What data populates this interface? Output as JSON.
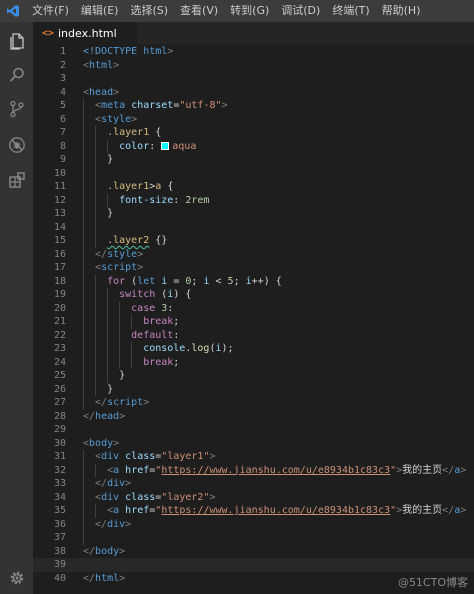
{
  "menubar": {
    "items": [
      "文件(F)",
      "编辑(E)",
      "选择(S)",
      "查看(V)",
      "转到(G)",
      "调试(D)",
      "终端(T)",
      "帮助(H)"
    ]
  },
  "activity_bar": {
    "icons": [
      "explorer-icon",
      "search-icon",
      "source-control-icon",
      "debug-icon",
      "extensions-icon",
      "settings-gear-icon"
    ]
  },
  "tab": {
    "icon": "<>",
    "filename": "index.html"
  },
  "editor": {
    "current_line": 39,
    "lines": [
      {
        "n": "1",
        "depth": 0,
        "tokens": [
          {
            "t": "<!DOCTYPE ",
            "c": "t-storage"
          },
          {
            "t": "html",
            "c": "t-tag"
          },
          {
            "t": ">",
            "c": "t-punc"
          }
        ]
      },
      {
        "n": "2",
        "depth": 0,
        "tokens": [
          {
            "t": "<",
            "c": "t-punc"
          },
          {
            "t": "html",
            "c": "t-tag"
          },
          {
            "t": ">",
            "c": "t-punc"
          }
        ]
      },
      {
        "n": "3",
        "depth": 0,
        "tokens": []
      },
      {
        "n": "4",
        "depth": 0,
        "tokens": [
          {
            "t": "<",
            "c": "t-punc"
          },
          {
            "t": "head",
            "c": "t-tag"
          },
          {
            "t": ">",
            "c": "t-punc"
          }
        ]
      },
      {
        "n": "5",
        "depth": 1,
        "tokens": [
          {
            "t": "<",
            "c": "t-punc"
          },
          {
            "t": "meta",
            "c": "t-tag"
          },
          {
            "t": " ",
            "c": ""
          },
          {
            "t": "charset",
            "c": "t-attr"
          },
          {
            "t": "=",
            "c": ""
          },
          {
            "t": "\"utf-8\"",
            "c": "t-str"
          },
          {
            "t": ">",
            "c": "t-punc"
          }
        ]
      },
      {
        "n": "6",
        "depth": 1,
        "tokens": [
          {
            "t": "<",
            "c": "t-punc"
          },
          {
            "t": "style",
            "c": "t-tag"
          },
          {
            "t": ">",
            "c": "t-punc"
          }
        ]
      },
      {
        "n": "7",
        "depth": 2,
        "tokens": [
          {
            "t": ".layer1",
            "c": "t-sel"
          },
          {
            "t": " {",
            "c": ""
          }
        ]
      },
      {
        "n": "8",
        "depth": 3,
        "tokens": [
          {
            "t": "color",
            "c": "t-attr"
          },
          {
            "t": ": ",
            "c": ""
          },
          {
            "swatch": "#00ffff"
          },
          {
            "t": "aqua",
            "c": "t-str"
          }
        ]
      },
      {
        "n": "9",
        "depth": 2,
        "tokens": [
          {
            "t": "}",
            "c": ""
          }
        ]
      },
      {
        "n": "10",
        "depth": 2,
        "tokens": []
      },
      {
        "n": "11",
        "depth": 2,
        "tokens": [
          {
            "t": ".layer1",
            "c": "t-sel"
          },
          {
            "t": ">",
            "c": ""
          },
          {
            "t": "a",
            "c": "t-sel"
          },
          {
            "t": " {",
            "c": ""
          }
        ]
      },
      {
        "n": "12",
        "depth": 3,
        "tokens": [
          {
            "t": "font-size",
            "c": "t-attr"
          },
          {
            "t": ": ",
            "c": ""
          },
          {
            "t": "2rem",
            "c": "t-num"
          }
        ]
      },
      {
        "n": "13",
        "depth": 2,
        "tokens": [
          {
            "t": "}",
            "c": ""
          }
        ]
      },
      {
        "n": "14",
        "depth": 2,
        "tokens": []
      },
      {
        "n": "15",
        "depth": 2,
        "tokens": [
          {
            "t": ".layer2",
            "c": "t-sel t-warn"
          },
          {
            "t": " {}",
            "c": ""
          }
        ]
      },
      {
        "n": "16",
        "depth": 1,
        "tokens": [
          {
            "t": "</",
            "c": "t-punc"
          },
          {
            "t": "style",
            "c": "t-tag"
          },
          {
            "t": ">",
            "c": "t-punc"
          }
        ]
      },
      {
        "n": "17",
        "depth": 1,
        "tokens": [
          {
            "t": "<",
            "c": "t-punc"
          },
          {
            "t": "script",
            "c": "t-tag"
          },
          {
            "t": ">",
            "c": "t-punc"
          }
        ]
      },
      {
        "n": "18",
        "depth": 2,
        "tokens": [
          {
            "t": "for",
            "c": "t-kw"
          },
          {
            "t": " (",
            "c": ""
          },
          {
            "t": "let",
            "c": "t-storage"
          },
          {
            "t": " ",
            "c": ""
          },
          {
            "t": "i",
            "c": "t-attr"
          },
          {
            "t": " = ",
            "c": ""
          },
          {
            "t": "0",
            "c": "t-num"
          },
          {
            "t": "; ",
            "c": ""
          },
          {
            "t": "i",
            "c": "t-attr"
          },
          {
            "t": " < ",
            "c": ""
          },
          {
            "t": "5",
            "c": "t-num"
          },
          {
            "t": "; ",
            "c": ""
          },
          {
            "t": "i",
            "c": "t-attr"
          },
          {
            "t": "++) {",
            "c": ""
          }
        ]
      },
      {
        "n": "19",
        "depth": 3,
        "tokens": [
          {
            "t": "switch",
            "c": "t-kw"
          },
          {
            "t": " (",
            "c": ""
          },
          {
            "t": "i",
            "c": "t-attr"
          },
          {
            "t": ") {",
            "c": ""
          }
        ]
      },
      {
        "n": "20",
        "depth": 4,
        "tokens": [
          {
            "t": "case",
            "c": "t-kw"
          },
          {
            "t": " ",
            "c": ""
          },
          {
            "t": "3",
            "c": "t-num"
          },
          {
            "t": ":",
            "c": ""
          }
        ]
      },
      {
        "n": "21",
        "depth": 5,
        "tokens": [
          {
            "t": "break",
            "c": "t-kw"
          },
          {
            "t": ";",
            "c": ""
          }
        ]
      },
      {
        "n": "22",
        "depth": 4,
        "tokens": [
          {
            "t": "default",
            "c": "t-kw"
          },
          {
            "t": ":",
            "c": ""
          }
        ]
      },
      {
        "n": "23",
        "depth": 5,
        "tokens": [
          {
            "t": "console",
            "c": "t-attr"
          },
          {
            "t": ".",
            "c": ""
          },
          {
            "t": "log",
            "c": "t-func"
          },
          {
            "t": "(",
            "c": ""
          },
          {
            "t": "i",
            "c": "t-attr"
          },
          {
            "t": ");",
            "c": ""
          }
        ]
      },
      {
        "n": "24",
        "depth": 5,
        "tokens": [
          {
            "t": "break",
            "c": "t-kw"
          },
          {
            "t": ";",
            "c": ""
          }
        ]
      },
      {
        "n": "25",
        "depth": 3,
        "tokens": [
          {
            "t": "}",
            "c": ""
          }
        ]
      },
      {
        "n": "26",
        "depth": 2,
        "tokens": [
          {
            "t": "}",
            "c": ""
          }
        ]
      },
      {
        "n": "27",
        "depth": 1,
        "tokens": [
          {
            "t": "</",
            "c": "t-punc"
          },
          {
            "t": "script",
            "c": "t-tag"
          },
          {
            "t": ">",
            "c": "t-punc"
          }
        ]
      },
      {
        "n": "28",
        "depth": 0,
        "tokens": [
          {
            "t": "</",
            "c": "t-punc"
          },
          {
            "t": "head",
            "c": "t-tag"
          },
          {
            "t": ">",
            "c": "t-punc"
          }
        ]
      },
      {
        "n": "29",
        "depth": 0,
        "tokens": []
      },
      {
        "n": "30",
        "depth": 0,
        "tokens": [
          {
            "t": "<",
            "c": "t-punc"
          },
          {
            "t": "body",
            "c": "t-tag"
          },
          {
            "t": ">",
            "c": "t-punc"
          }
        ]
      },
      {
        "n": "31",
        "depth": 1,
        "tokens": [
          {
            "t": "<",
            "c": "t-punc"
          },
          {
            "t": "div",
            "c": "t-tag"
          },
          {
            "t": " ",
            "c": ""
          },
          {
            "t": "class",
            "c": "t-attr"
          },
          {
            "t": "=",
            "c": ""
          },
          {
            "t": "\"layer1\"",
            "c": "t-str"
          },
          {
            "t": ">",
            "c": "t-punc"
          }
        ]
      },
      {
        "n": "32",
        "depth": 2,
        "tokens": [
          {
            "t": "<",
            "c": "t-punc"
          },
          {
            "t": "a",
            "c": "t-tag"
          },
          {
            "t": " ",
            "c": ""
          },
          {
            "t": "href",
            "c": "t-attr"
          },
          {
            "t": "=",
            "c": ""
          },
          {
            "t": "\"",
            "c": "t-str"
          },
          {
            "t": "https://www.jianshu.com/u/e8934b1c83c3",
            "c": "t-str t-url"
          },
          {
            "t": "\"",
            "c": "t-str"
          },
          {
            "t": ">",
            "c": "t-punc"
          },
          {
            "t": "我的主页",
            "c": ""
          },
          {
            "t": "</",
            "c": "t-punc"
          },
          {
            "t": "a",
            "c": "t-tag"
          },
          {
            "t": ">",
            "c": "t-punc"
          }
        ]
      },
      {
        "n": "33",
        "depth": 1,
        "tokens": [
          {
            "t": "</",
            "c": "t-punc"
          },
          {
            "t": "div",
            "c": "t-tag"
          },
          {
            "t": ">",
            "c": "t-punc"
          }
        ]
      },
      {
        "n": "34",
        "depth": 1,
        "tokens": [
          {
            "t": "<",
            "c": "t-punc"
          },
          {
            "t": "div",
            "c": "t-tag"
          },
          {
            "t": " ",
            "c": ""
          },
          {
            "t": "class",
            "c": "t-attr"
          },
          {
            "t": "=",
            "c": ""
          },
          {
            "t": "\"layer2\"",
            "c": "t-str"
          },
          {
            "t": ">",
            "c": "t-punc"
          }
        ]
      },
      {
        "n": "35",
        "depth": 2,
        "tokens": [
          {
            "t": "<",
            "c": "t-punc"
          },
          {
            "t": "a",
            "c": "t-tag"
          },
          {
            "t": " ",
            "c": ""
          },
          {
            "t": "href",
            "c": "t-attr"
          },
          {
            "t": "=",
            "c": ""
          },
          {
            "t": "\"",
            "c": "t-str"
          },
          {
            "t": "https://www.jianshu.com/u/e8934b1c83c3",
            "c": "t-str t-url"
          },
          {
            "t": "\"",
            "c": "t-str"
          },
          {
            "t": ">",
            "c": "t-punc"
          },
          {
            "t": "我的主页",
            "c": ""
          },
          {
            "t": "</",
            "c": "t-punc"
          },
          {
            "t": "a",
            "c": "t-tag"
          },
          {
            "t": ">",
            "c": "t-punc"
          }
        ]
      },
      {
        "n": "36",
        "depth": 1,
        "tokens": [
          {
            "t": "</",
            "c": "t-punc"
          },
          {
            "t": "div",
            "c": "t-tag"
          },
          {
            "t": ">",
            "c": "t-punc"
          }
        ]
      },
      {
        "n": "37",
        "depth": 1,
        "tokens": []
      },
      {
        "n": "38",
        "depth": 0,
        "tokens": [
          {
            "t": "</",
            "c": "t-punc"
          },
          {
            "t": "body",
            "c": "t-tag"
          },
          {
            "t": ">",
            "c": "t-punc"
          }
        ]
      },
      {
        "n": "39",
        "depth": 0,
        "tokens": []
      },
      {
        "n": "40",
        "depth": 0,
        "tokens": [
          {
            "t": "</",
            "c": "t-punc"
          },
          {
            "t": "html",
            "c": "t-tag"
          },
          {
            "t": ">",
            "c": "t-punc"
          }
        ]
      }
    ]
  },
  "watermark": "@51CTO博客"
}
